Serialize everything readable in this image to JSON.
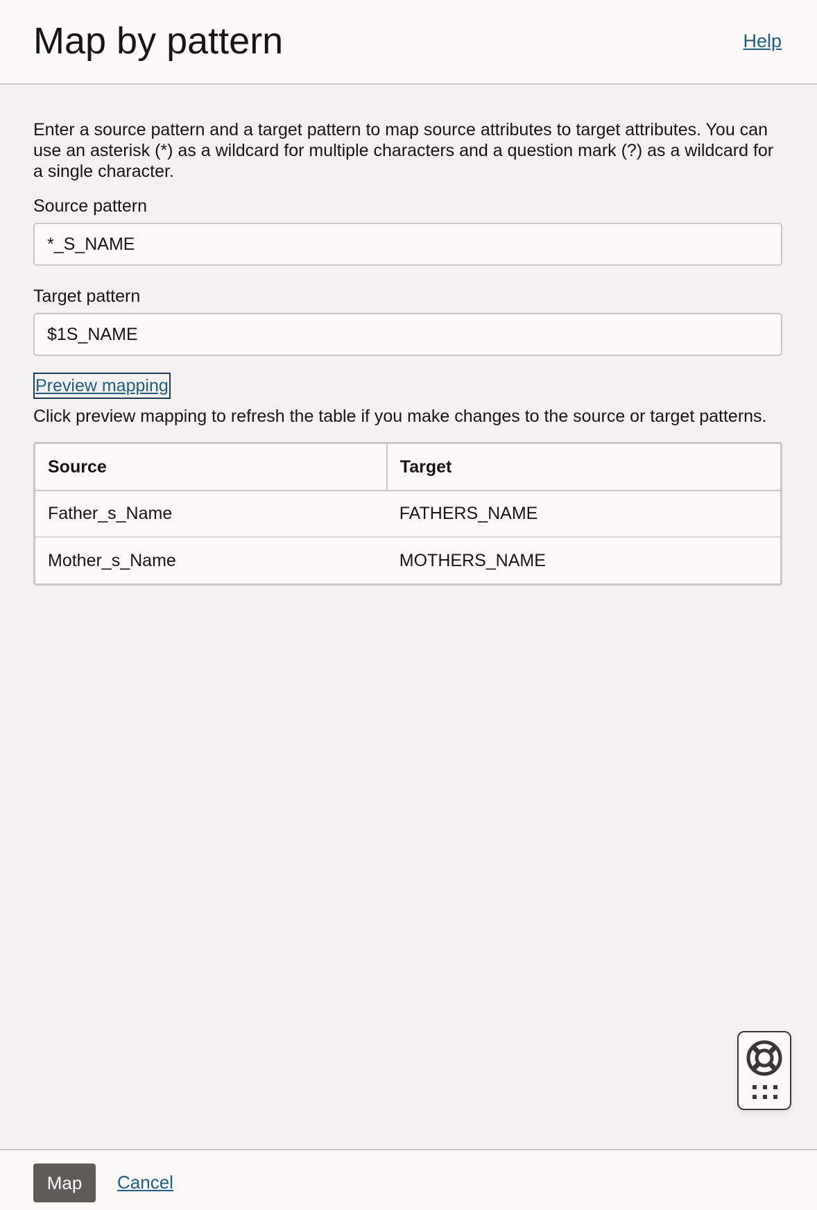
{
  "header": {
    "title": "Map by pattern",
    "help_label": "Help"
  },
  "main": {
    "intro": "Enter a source pattern and a target pattern to map source attributes to target attributes. You can use an asterisk (*) as a wildcard for multiple characters and a question mark (?) as a wildcard for a single character.",
    "source_pattern": {
      "label": "Source pattern",
      "value": "*_S_NAME"
    },
    "target_pattern": {
      "label": "Target pattern",
      "value": "$1S_NAME"
    },
    "preview_label": "Preview mapping",
    "hint": "Click preview mapping to refresh the table if you make changes to the source or target patterns.",
    "table": {
      "columns": [
        "Source",
        "Target"
      ],
      "rows": [
        [
          "Father_s_Name",
          "FATHERS_NAME"
        ],
        [
          "Mother_s_Name",
          "MOTHERS_NAME"
        ]
      ]
    }
  },
  "footer": {
    "map_label": "Map",
    "cancel_label": "Cancel"
  },
  "help_widget": {
    "icon": "lifebuoy-icon",
    "drag_icon": "grid-dots-icon"
  },
  "colors": {
    "link": "#1e5d80",
    "primary_button": "#5f5b57",
    "background": "#f3f2f1",
    "surface": "#fbfaf9"
  }
}
